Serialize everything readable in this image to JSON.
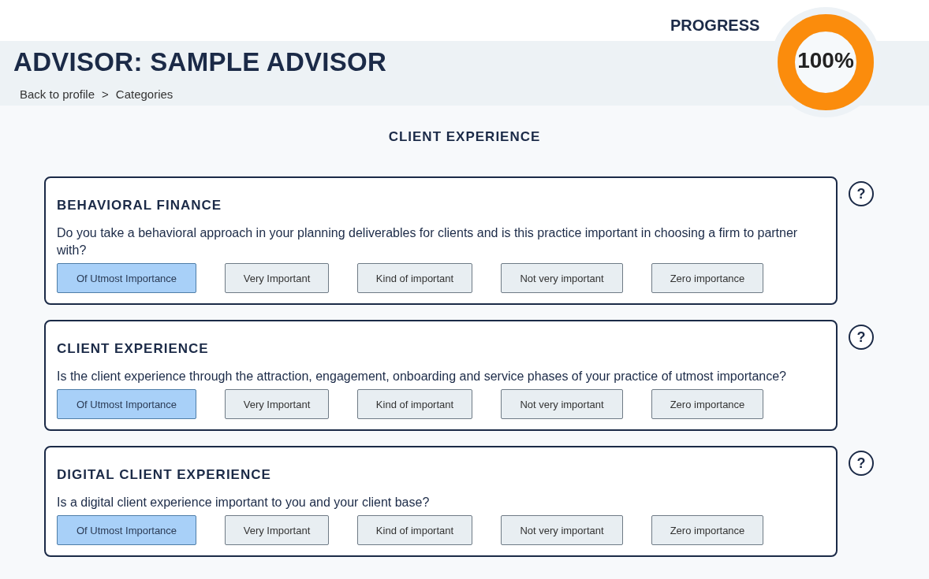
{
  "progress": {
    "label": "PROGRESS",
    "value": "100%",
    "level": 1
  },
  "header": {
    "title": "ADVISOR: SAMPLE ADVISOR",
    "breadcrumb": [
      {
        "label": "Back to profile"
      },
      {
        "label": "Categories"
      }
    ],
    "separator": ">"
  },
  "section_title": "CLIENT EXPERIENCE",
  "questions": [
    {
      "title": "BEHAVIORAL FINANCE",
      "text": "Do you take a behavioral approach in your planning deliverables for clients and is this practice important in choosing a firm to partner with?",
      "help": "?",
      "options": [
        {
          "label": "Of Utmost Importance",
          "selected": true
        },
        {
          "label": "Very Important",
          "selected": false
        },
        {
          "label": "Kind of important",
          "selected": false
        },
        {
          "label": "Not very important",
          "selected": false
        },
        {
          "label": "Zero importance",
          "selected": false
        }
      ]
    },
    {
      "title": "CLIENT EXPERIENCE",
      "text": "Is the client experience through the attraction, engagement, onboarding and service phases of your practice of utmost importance?",
      "help": "?",
      "options": [
        {
          "label": "Of Utmost Importance",
          "selected": true
        },
        {
          "label": "Very Important",
          "selected": false
        },
        {
          "label": "Kind of important",
          "selected": false
        },
        {
          "label": "Not very important",
          "selected": false
        },
        {
          "label": "Zero importance",
          "selected": false
        }
      ]
    },
    {
      "title": "DIGITAL CLIENT EXPERIENCE",
      "text": "Is a digital client experience important to you and your client base?",
      "help": "?",
      "options": [
        {
          "label": "Of Utmost Importance",
          "selected": true
        },
        {
          "label": "Very Important",
          "selected": false
        },
        {
          "label": "Kind of important",
          "selected": false
        },
        {
          "label": "Not very important",
          "selected": false
        },
        {
          "label": "Zero importance",
          "selected": false
        }
      ]
    }
  ]
}
